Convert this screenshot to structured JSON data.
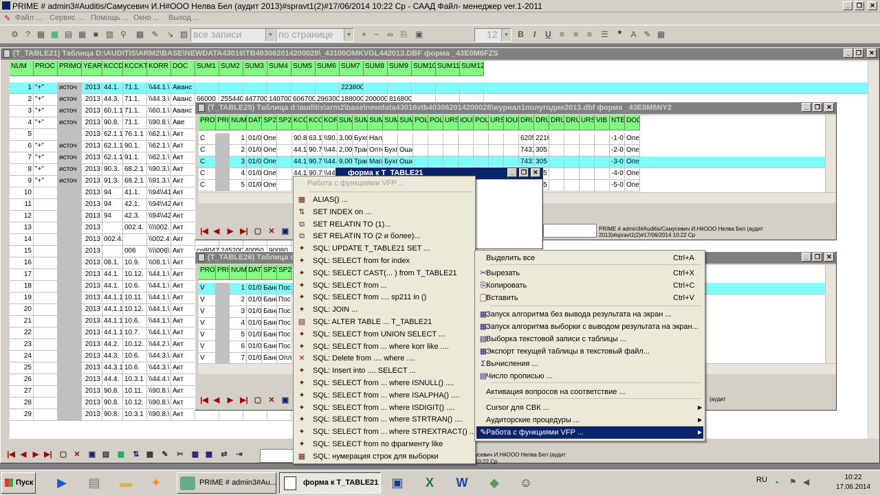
{
  "app": {
    "title": "PRIME # admin3#Auditis/Самусевич И.Н#ООО Нелва Бел (аудит 2013)#spravt1(2)#17/06/2014 10:22 Ср - САAД Файл- менеджер ver.1-2011",
    "menu": [
      "Файл ...",
      "Сервис ...",
      "Помощь ...",
      "Окно ...",
      "Выход ..."
    ]
  },
  "toolbar": {
    "records_combo": "все записи",
    "page_combo": "по странице",
    "font_size": "12",
    "bold": "B",
    "italic": "I",
    "underline": "U"
  },
  "win1": {
    "title": "(T_TABLE21)  Таблица D:\\AUDITIS\\ARM2\\BASE\\NEWDATA43016\\TB403062014200028\\_43100OMKVGL442013.DBF форма _43E0M6FZS",
    "columns": [
      "NUM",
      "PROC",
      "PRIMO",
      "YEAR",
      "KCCDTID",
      "KCCKTID",
      "KORR",
      "DOC",
      "SUM1",
      "SUM2",
      "SUM3",
      "SUM4",
      "SUM5",
      "SUM6",
      "SUM7",
      "SUM8",
      "SUM9",
      "SUM10",
      "SUM11",
      "SUM12"
    ],
    "rows": [
      [
        "1",
        "\"+\"",
        "источ",
        "2013",
        "44.1.",
        "71.1.",
        "\\\\44.1.\\",
        "Аванс",
        "",
        "",
        "",
        "",
        "",
        "",
        "223800",
        "",
        "",
        "",
        "",
        ""
      ],
      [
        "2",
        "\"+\"",
        "источ",
        "2013",
        "44.3.",
        "71.1.",
        "\\\\44.3.\\",
        "Аванс",
        "66000",
        "255440",
        "447700",
        "140700",
        "606700",
        "296300",
        "188000",
        "200000",
        "816800",
        "",
        "",
        ""
      ],
      [
        "3",
        "\"+\"",
        "источ",
        "2013",
        "60.1.1",
        "71.1.",
        "\\\\60.1.\\",
        "Аванс",
        "",
        "",
        "",
        "",
        "",
        "",
        "",
        "",
        "",
        "",
        "",
        ""
      ],
      [
        "4",
        "\"+\"",
        "источ",
        "2013",
        "90.8.",
        "71.1.",
        "\\\\90.8.\\",
        "Аве",
        "",
        "",
        "",
        "",
        "",
        "",
        "",
        "",
        "",
        "",
        "",
        ""
      ],
      [
        "5",
        "",
        "",
        "2013",
        "62.1.1",
        "76.1.1",
        "\\\\62.1.\\",
        "Акт",
        "",
        "",
        "",
        "",
        "",
        "",
        "",
        "",
        "",
        "",
        "",
        ""
      ],
      [
        "6",
        "\"+\"",
        "источ",
        "2013",
        "62.1.1",
        "90.1.",
        "\\\\62.1.\\",
        "Акт",
        "",
        "",
        "",
        "",
        "",
        "",
        "",
        "",
        "",
        "",
        "",
        ""
      ],
      [
        "7",
        "\"+\"",
        "источ",
        "2013",
        "62.1.1",
        "91.1.",
        "\\\\62.1.\\",
        "Акт",
        "",
        "",
        "",
        "",
        "",
        "",
        "",
        "",
        "",
        "",
        "",
        ""
      ],
      [
        "8",
        "\"+\"",
        "источ",
        "2013",
        "90.3.",
        "68.2.1",
        "\\\\90.3.\\",
        "Акт",
        "",
        "",
        "",
        "",
        "",
        "",
        "",
        "",
        "",
        "",
        "",
        ""
      ],
      [
        "9",
        "\"+\"",
        "источ",
        "2013",
        "91.3.",
        "68.2.1",
        "\\\\91.3.\\",
        "Акт",
        "",
        "",
        "",
        "",
        "",
        "",
        "",
        "",
        "",
        "",
        "",
        ""
      ],
      [
        "10",
        "",
        "",
        "2013",
        "94",
        "41.1.",
        "\\\\94\\\\41",
        "Акт",
        "",
        "",
        "",
        "",
        "",
        "",
        "",
        "",
        "",
        "",
        "",
        ""
      ],
      [
        "11",
        "",
        "",
        "2013",
        "94",
        "42.1.",
        "\\\\94\\\\42",
        "Акт",
        "",
        "",
        "",
        "",
        "",
        "",
        "",
        "",
        "",
        "",
        "",
        ""
      ],
      [
        "12",
        "",
        "",
        "2013",
        "94",
        "42.3.",
        "\\\\94\\\\42",
        "Акт",
        "",
        "",
        "",
        "",
        "",
        "",
        "",
        "",
        "",
        "",
        "",
        ""
      ],
      [
        "13",
        "",
        "",
        "2013",
        "",
        "002.4.",
        "\\\\\\\\002.",
        "Акт",
        "",
        "",
        "",
        "",
        "",
        "",
        "",
        "",
        "",
        "",
        "",
        ""
      ],
      [
        "14",
        "",
        "",
        "2013",
        "002.4.",
        "",
        "\\\\002.4",
        "Акт",
        "",
        "",
        "",
        "",
        "",
        "",
        "",
        "",
        "",
        "",
        "",
        ""
      ],
      [
        "15",
        "",
        "",
        "2013",
        "",
        "006",
        "\\\\\\\\006\\",
        "Акт",
        "cn80475",
        "245200",
        "40050",
        "90080",
        "",
        "",
        "",
        "",
        "",
        "",
        "",
        ""
      ],
      [
        "16",
        "",
        "",
        "2013",
        "08.1.",
        "10.9.",
        "\\\\08.1.\\",
        "Акт",
        "",
        "",
        "",
        "",
        "",
        "",
        "",
        "",
        "",
        "",
        "",
        ""
      ],
      [
        "17",
        "",
        "",
        "2013",
        "44.1.",
        "10.12.",
        "\\\\44.1.\\",
        "Акт",
        "",
        "",
        "",
        "",
        "",
        "",
        "",
        "",
        "",
        "",
        "",
        ""
      ],
      [
        "18",
        "",
        "",
        "2013",
        "44.1.",
        "10.6.",
        "\\\\44.1.\\",
        "Акт",
        "",
        "",
        "",
        "",
        "",
        "",
        "",
        "",
        "",
        "",
        "",
        ""
      ],
      [
        "19",
        "",
        "",
        "2013",
        "44.1.1",
        "10.11.",
        "\\\\44.1.\\",
        "Акт",
        "",
        "",
        "",
        "",
        "",
        "",
        "",
        "",
        "",
        "",
        "",
        ""
      ],
      [
        "20",
        "",
        "",
        "2013",
        "44.1.1",
        "10.12.",
        "\\\\44.1.\\",
        "Акт",
        "",
        "",
        "",
        "",
        "",
        "",
        "",
        "",
        "",
        "",
        "",
        ""
      ],
      [
        "21",
        "",
        "",
        "2013",
        "44.1.1",
        "10.6.",
        "\\\\44.1.\\",
        "Акт",
        "",
        "",
        "",
        "",
        "",
        "",
        "",
        "",
        "",
        "",
        "",
        ""
      ],
      [
        "22",
        "",
        "",
        "2013",
        "44.1.1",
        "10.7.",
        "\\\\44.1.\\",
        "Акт",
        "",
        "",
        "",
        "",
        "",
        "",
        "",
        "",
        "",
        "",
        "",
        ""
      ],
      [
        "23",
        "",
        "",
        "2013",
        "44.2.",
        "10.12.",
        "\\\\44.2.\\",
        "Акт",
        "",
        "",
        "",
        "",
        "",
        "",
        "",
        "",
        "",
        "",
        "",
        ""
      ],
      [
        "24",
        "",
        "",
        "2013",
        "44.3.",
        "10.6.",
        "\\\\44.3.\\",
        "Акт",
        "",
        "",
        "",
        "",
        "",
        "",
        "",
        "",
        "",
        "",
        "",
        ""
      ],
      [
        "25",
        "",
        "",
        "2013",
        "44.3.1",
        "10.6.",
        "\\\\44.3.\\",
        "Акт",
        "",
        "",
        "",
        "",
        "",
        "",
        "",
        "",
        "",
        "",
        "",
        ""
      ],
      [
        "26",
        "",
        "",
        "2013",
        "44.4.",
        "10.3.1",
        "\\\\44.4.\\",
        "Акт",
        "",
        "",
        "",
        "",
        "",
        "",
        "",
        "",
        "",
        "",
        "",
        ""
      ],
      [
        "27",
        "",
        "",
        "2013",
        "90.8.",
        "10.11.",
        "\\\\90.8.\\",
        "Акт",
        "",
        "",
        "",
        "",
        "",
        "",
        "",
        "",
        "",
        "",
        "",
        ""
      ],
      [
        "28",
        "",
        "",
        "2013",
        "90.8.",
        "10.12.",
        "\\\\90.8.\\",
        "Акт",
        "",
        "",
        "",
        "",
        "",
        "",
        "",
        "",
        "",
        "",
        "",
        ""
      ],
      [
        "29",
        "",
        "",
        "2013",
        "90.8.",
        "10.3.1",
        "\\\\90.8.\\",
        "Акт",
        "",
        "",
        "",
        "",
        "",
        "",
        "",
        "",
        "",
        "",
        "",
        ""
      ]
    ]
  },
  "win2": {
    "title": "(T_TABLE25)  Таблица d:\\auditis\\arm2\\base\\newdata43016vtb403062014200028\\журнал1полугодие2013.dbf форма _43E0M6NY2",
    "columns": [
      "PROC",
      "PRIMO",
      "NUM",
      "DATE",
      "SP211",
      "SP212",
      "KCCDT",
      "KCCKT",
      "KORR",
      "SUM",
      "SUM_",
      "SUM_",
      "SUM_",
      "SUM_",
      "POL",
      "POLE",
      "URS",
      "IOUN",
      "POLE",
      "URS",
      "IOUN",
      "DRUS",
      "DRUS",
      "DRUS",
      "DRUS",
      "URS",
      "VIB",
      "NTEX",
      "DOC"
    ],
    "rows": [
      [
        "C",
        "",
        "1",
        "01/0",
        "Опер",
        "",
        "90.8.",
        "63.1",
        "\\\\90.8",
        "3,00",
        "Бухг",
        "Нало",
        "",
        "",
        "",
        "",
        "",
        "",
        "",
        "",
        "",
        "6205",
        "2216",
        "",
        "",
        "",
        "",
        "-1-0",
        "Опер"
      ],
      [
        "C",
        "",
        "2",
        "01/0",
        "Опер",
        "",
        "44.1",
        "90.7",
        "\\\\44.1",
        "2,00",
        "Тран",
        "Опто",
        "Бухг",
        "Оши",
        "",
        "",
        "",
        "",
        "",
        "",
        "",
        "7431",
        "305",
        "",
        "",
        "",
        "",
        "-2-0",
        "Опер"
      ],
      [
        "C",
        "",
        "3",
        "01/0",
        "Опер",
        "",
        "44.1",
        "90.7",
        "\\\\44.1",
        "9,00",
        "Тран",
        "Мага",
        "Бухг",
        "Оши",
        "",
        "",
        "",
        "",
        "",
        "",
        "",
        "7431",
        "305",
        "",
        "",
        "",
        "",
        "-3-0",
        "Опер"
      ],
      [
        "C",
        "",
        "4",
        "01/0",
        "Опер",
        "",
        "44.1",
        "90.7",
        "\\\\44.1",
        "",
        "",
        "",
        "",
        "",
        "",
        "",
        "",
        "",
        "",
        "",
        "",
        "",
        "305",
        "",
        "",
        "",
        "",
        "-4-0",
        "Опер"
      ],
      [
        "C",
        "",
        "5",
        "01/0",
        "Опер",
        "",
        "44.1",
        "90.7",
        "\\\\44.1",
        "",
        "",
        "",
        "",
        "",
        "",
        "",
        "",
        "",
        "",
        "",
        "",
        "",
        "305",
        "",
        "",
        "",
        "",
        "-5-0",
        "Опер"
      ]
    ],
    "info_line1": "PRIME # admin3#Auditis/Самусевич И.Н#ООО Нелва Бел (аудит",
    "info_line2": "2013)#spravt1(2)#17/06/2014 10:22 Ср"
  },
  "win3": {
    "title": "(T_TABLE26)  Таблица d",
    "columns": [
      "PROC",
      "PRIMO",
      "NUM",
      "DATE",
      "SP211",
      "SP21"
    ],
    "rows": [
      [
        "V",
        "",
        "1",
        "01/0",
        "Банк",
        "Пос"
      ],
      [
        "V",
        "",
        "2",
        "01/0",
        "Банк",
        "Пос"
      ],
      [
        "V",
        "",
        "3",
        "01/0",
        "Банк",
        "Пос"
      ],
      [
        "V",
        "",
        "4",
        "01/0",
        "Банк",
        "Пос"
      ],
      [
        "V",
        "",
        "5",
        "01/0",
        "Банк",
        "Пос"
      ],
      [
        "V",
        "",
        "6",
        "01/0",
        "Банк",
        "Пос"
      ],
      [
        "V",
        "",
        "7",
        "01/0",
        "Банк",
        "Опл"
      ]
    ],
    "info_line1": "(аудит"
  },
  "form_window": {
    "title": "форма к T_TABLE21"
  },
  "vfp_menu": {
    "header": "Работа с функциями VFP ...",
    "items": [
      {
        "icon": "table-icon",
        "glyph": "▦",
        "label": "ALIAS() ..."
      },
      {
        "icon": "sort-icon",
        "glyph": "⇅",
        "label": "SET INDEX on ..."
      },
      {
        "icon": "relation-icon",
        "glyph": "⧉",
        "label": "SET RELATIN TO (1)..."
      },
      {
        "icon": "relation-icon",
        "glyph": "⧉",
        "label": "SET RELATIN TO (2 и более)..."
      },
      {
        "icon": "sql-icon",
        "glyph": "✦",
        "label": "SQL: UPDATE T_TABLE21 SET  ..."
      },
      {
        "icon": "sql-icon",
        "glyph": "✦",
        "label": "SQL: SELECT from for index"
      },
      {
        "icon": "sql-icon",
        "glyph": "✦",
        "label": "SQL: SELECT CAST(... ) from T_TABLE21"
      },
      {
        "icon": "sql-icon",
        "glyph": "✦",
        "label": "SQL: SELECT from ..."
      },
      {
        "icon": "sql-icon",
        "glyph": "✦",
        "label": "SQL: SELECT from .... sp211 in ()"
      },
      {
        "icon": "sql-icon",
        "glyph": "✦",
        "label": "SQL: JOIN ..."
      },
      {
        "icon": "alter-table-icon",
        "glyph": "▤",
        "label": "SQL: ALTER TABLE ... T_TABLE21"
      },
      {
        "icon": "sql-icon",
        "glyph": "✦",
        "label": "SQL: SELECT from UNION SELECT ..."
      },
      {
        "icon": "sql-icon",
        "glyph": "✦",
        "label": "SQL: SELECT from ... where korr like ...."
      },
      {
        "icon": "delete-icon",
        "glyph": "✕",
        "label": "SQL: Delete from .... where ...."
      },
      {
        "icon": "sql-icon",
        "glyph": "✦",
        "label": "SQL: Insert into .... SELECT ..."
      },
      {
        "icon": "sql-icon",
        "glyph": "✦",
        "label": "SQL: SELECT from ... where ISNULL() ...."
      },
      {
        "icon": "sql-icon",
        "glyph": "✦",
        "label": "SQL: SELECT from ... where ISALPHA() ...."
      },
      {
        "icon": "sql-icon",
        "glyph": "✦",
        "label": "SQL: SELECT from ... where ISDIGIT() ...."
      },
      {
        "icon": "sql-icon",
        "glyph": "✦",
        "label": "SQL: SELECT from ... where STRTRAN() ...."
      },
      {
        "icon": "sql-icon",
        "glyph": "✦",
        "label": "SQL: SELECT from ... where STREXTRACT() ...."
      },
      {
        "icon": "sql-icon",
        "glyph": "✦",
        "label": "SQL: SELECT from по фрагменту like"
      },
      {
        "icon": "numbering-icon",
        "glyph": "▦",
        "label": "SQL: нумерация строк для выборки"
      }
    ]
  },
  "context_menu": {
    "items": [
      {
        "label": "Выделить все",
        "shortcut": "Ctrl+A",
        "icon": "",
        "glyph": ""
      },
      {
        "label": "Вырезать",
        "shortcut": "Ctrl+X",
        "icon": "cut-icon",
        "glyph": "✂"
      },
      {
        "label": "Копировать",
        "shortcut": "Ctrl+C",
        "icon": "copy-icon",
        "glyph": "⎘"
      },
      {
        "label": "Вставить",
        "shortcut": "Ctrl+V",
        "icon": "paste-icon",
        "glyph": "📋"
      },
      {
        "label": "Запуск алгоритма без вывода результата на экран ...",
        "shortcut": "",
        "icon": "run-icon",
        "glyph": "▦"
      },
      {
        "label": "Запуск алгоритма выборки с выводом результата на экран...",
        "shortcut": "",
        "icon": "run-output-icon",
        "glyph": "▦"
      },
      {
        "label": "Выборка текстовой записи с таблицы ...",
        "shortcut": "",
        "icon": "text-select-icon",
        "glyph": "▤"
      },
      {
        "label": "Экспорт текущей таблицы в текстовый файл...",
        "shortcut": "",
        "icon": "export-icon",
        "glyph": "▦"
      },
      {
        "label": "Вычисления ...",
        "shortcut": "",
        "icon": "calc-icon",
        "glyph": "Σ"
      },
      {
        "label": "Число прописью ...",
        "shortcut": "",
        "icon": "number-words-icon",
        "glyph": "▤"
      },
      {
        "label": "Активация вопросов на соответствие ...",
        "shortcut": "",
        "icon": "",
        "glyph": ""
      },
      {
        "label": "Cursor для СВК ...",
        "shortcut": "",
        "icon": "",
        "glyph": ""
      },
      {
        "label": "Аудиторские процедуры ...",
        "shortcut": "",
        "icon": "",
        "glyph": ""
      },
      {
        "label": "Работа с функциями VFP ...",
        "shortcut": "",
        "icon": "vfp-icon",
        "glyph": "✎"
      }
    ]
  },
  "bottom_status": {
    "line1": "усевич И.Н#ООО Нелва Бел (аудит",
    "line2": "10:22 Ср"
  },
  "taskbar": {
    "start": "Пуск",
    "buttons": [
      "PRIME # admin3#Au...",
      "форма к T_TABLE21"
    ],
    "lang": "RU",
    "time": "10:22",
    "date": "17.06.2014"
  }
}
